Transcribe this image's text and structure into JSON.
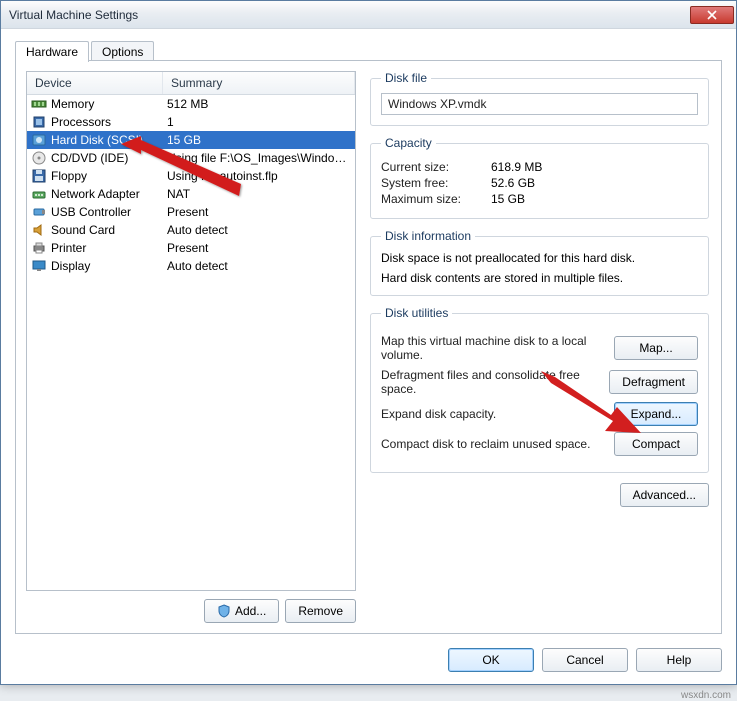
{
  "window": {
    "title": "Virtual Machine Settings"
  },
  "tabs": {
    "hardware": "Hardware",
    "options": "Options"
  },
  "table": {
    "headers": {
      "device": "Device",
      "summary": "Summary"
    },
    "rows": [
      {
        "device": "Memory",
        "summary": "512 MB",
        "icon": "memory"
      },
      {
        "device": "Processors",
        "summary": "1",
        "icon": "cpu"
      },
      {
        "device": "Hard Disk (SCSI)",
        "summary": "15 GB",
        "icon": "hdd",
        "selected": true
      },
      {
        "device": "CD/DVD (IDE)",
        "summary": "Using file F:\\OS_Images\\Windows...",
        "icon": "cd"
      },
      {
        "device": "Floppy",
        "summary": "Using file autoinst.flp",
        "icon": "floppy"
      },
      {
        "device": "Network Adapter",
        "summary": "NAT",
        "icon": "net"
      },
      {
        "device": "USB Controller",
        "summary": "Present",
        "icon": "usb"
      },
      {
        "device": "Sound Card",
        "summary": "Auto detect",
        "icon": "sound"
      },
      {
        "device": "Printer",
        "summary": "Present",
        "icon": "printer"
      },
      {
        "device": "Display",
        "summary": "Auto detect",
        "icon": "display"
      }
    ],
    "buttons": {
      "add": "Add...",
      "remove": "Remove"
    }
  },
  "diskfile": {
    "legend": "Disk file",
    "value": "Windows XP.vmdk"
  },
  "capacity": {
    "legend": "Capacity",
    "current_size_label": "Current size:",
    "current_size": "618.9 MB",
    "system_free_label": "System free:",
    "system_free": "52.6 GB",
    "maximum_size_label": "Maximum size:",
    "maximum_size": "15 GB"
  },
  "diskinfo": {
    "legend": "Disk information",
    "line1": "Disk space is not preallocated for this hard disk.",
    "line2": "Hard disk contents are stored in multiple files."
  },
  "utilities": {
    "legend": "Disk utilities",
    "map_desc": "Map this virtual machine disk to a local volume.",
    "map_btn": "Map...",
    "defrag_desc": "Defragment files and consolidate free space.",
    "defrag_btn": "Defragment",
    "expand_desc": "Expand disk capacity.",
    "expand_btn": "Expand...",
    "compact_desc": "Compact disk to reclaim unused space.",
    "compact_btn": "Compact"
  },
  "advanced_btn": "Advanced...",
  "bottom": {
    "ok": "OK",
    "cancel": "Cancel",
    "help": "Help"
  },
  "source": "wsxdn.com"
}
